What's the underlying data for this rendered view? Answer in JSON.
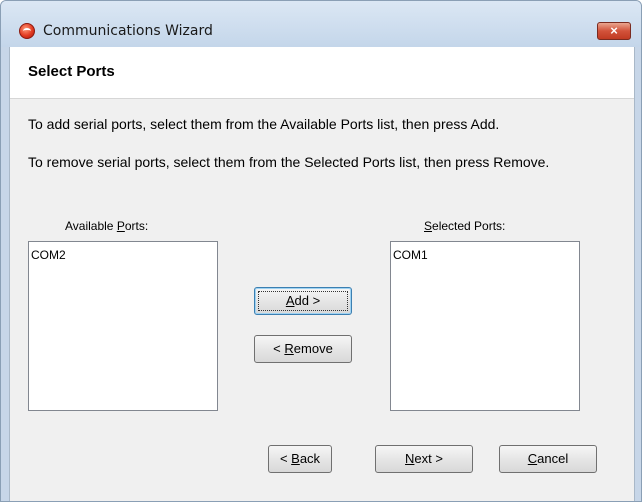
{
  "window": {
    "title": "Communications Wizard",
    "close_label": "×"
  },
  "page": {
    "title": "Select Ports",
    "instruction_add": "To add serial ports, select them from the Available Ports list, then press Add.",
    "instruction_remove": "To remove serial ports, select them from the Selected Ports list, then press Remove."
  },
  "available": {
    "label_pre": "Available ",
    "label_u": "P",
    "label_post": "orts:",
    "items": [
      "COM2"
    ]
  },
  "selected": {
    "label_pre": "",
    "label_u": "S",
    "label_post": "elected Ports:",
    "items": [
      "COM1"
    ]
  },
  "buttons": {
    "add": {
      "u": "A",
      "rest": "dd >"
    },
    "remove": {
      "pre": "< ",
      "u": "R",
      "rest": "emove"
    },
    "back": {
      "pre": "< ",
      "u": "B",
      "rest": "ack"
    },
    "next": {
      "u": "N",
      "rest": "ext >"
    },
    "cancel": {
      "u": "C",
      "rest": "ancel"
    }
  },
  "colors": {
    "accent": "#3c7fb1",
    "close_button": "#c03a22"
  },
  "icons": {
    "app": "app-logo-icon",
    "close": "close-icon"
  }
}
